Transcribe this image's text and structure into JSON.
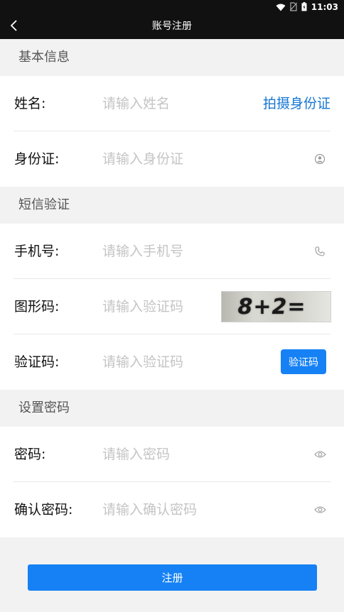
{
  "status_bar": {
    "time": "11:03"
  },
  "nav": {
    "title": "账号注册"
  },
  "sections": {
    "basic": "基本信息",
    "sms": "短信验证",
    "password": "设置密码"
  },
  "fields": {
    "name": {
      "label": "姓名:",
      "placeholder": "请输入姓名",
      "action": "拍摄身份证"
    },
    "id_card": {
      "label": "身份证:",
      "placeholder": "请输入身份证"
    },
    "phone": {
      "label": "手机号:",
      "placeholder": "请输入手机号"
    },
    "captcha": {
      "label": "图形码:",
      "placeholder": "请输入验证码",
      "captcha_image_text": "8+2="
    },
    "sms_code": {
      "label": "验证码:",
      "placeholder": "请输入验证码",
      "button": "验证码"
    },
    "password": {
      "label": "密码:",
      "placeholder": "请输入密码"
    },
    "confirm_password": {
      "label": "确认密码:",
      "placeholder": "请输入确认密码"
    }
  },
  "submit": {
    "label": "注册"
  },
  "colors": {
    "accent": "#1681f5",
    "link": "#1677d2",
    "header_bg": "#111111",
    "page_bg": "#f2f2f2"
  },
  "icons": [
    "wifi-icon",
    "no-sim-icon",
    "battery-icon",
    "back-chevron-icon",
    "user-circle-icon",
    "phone-icon",
    "eye-icon"
  ]
}
